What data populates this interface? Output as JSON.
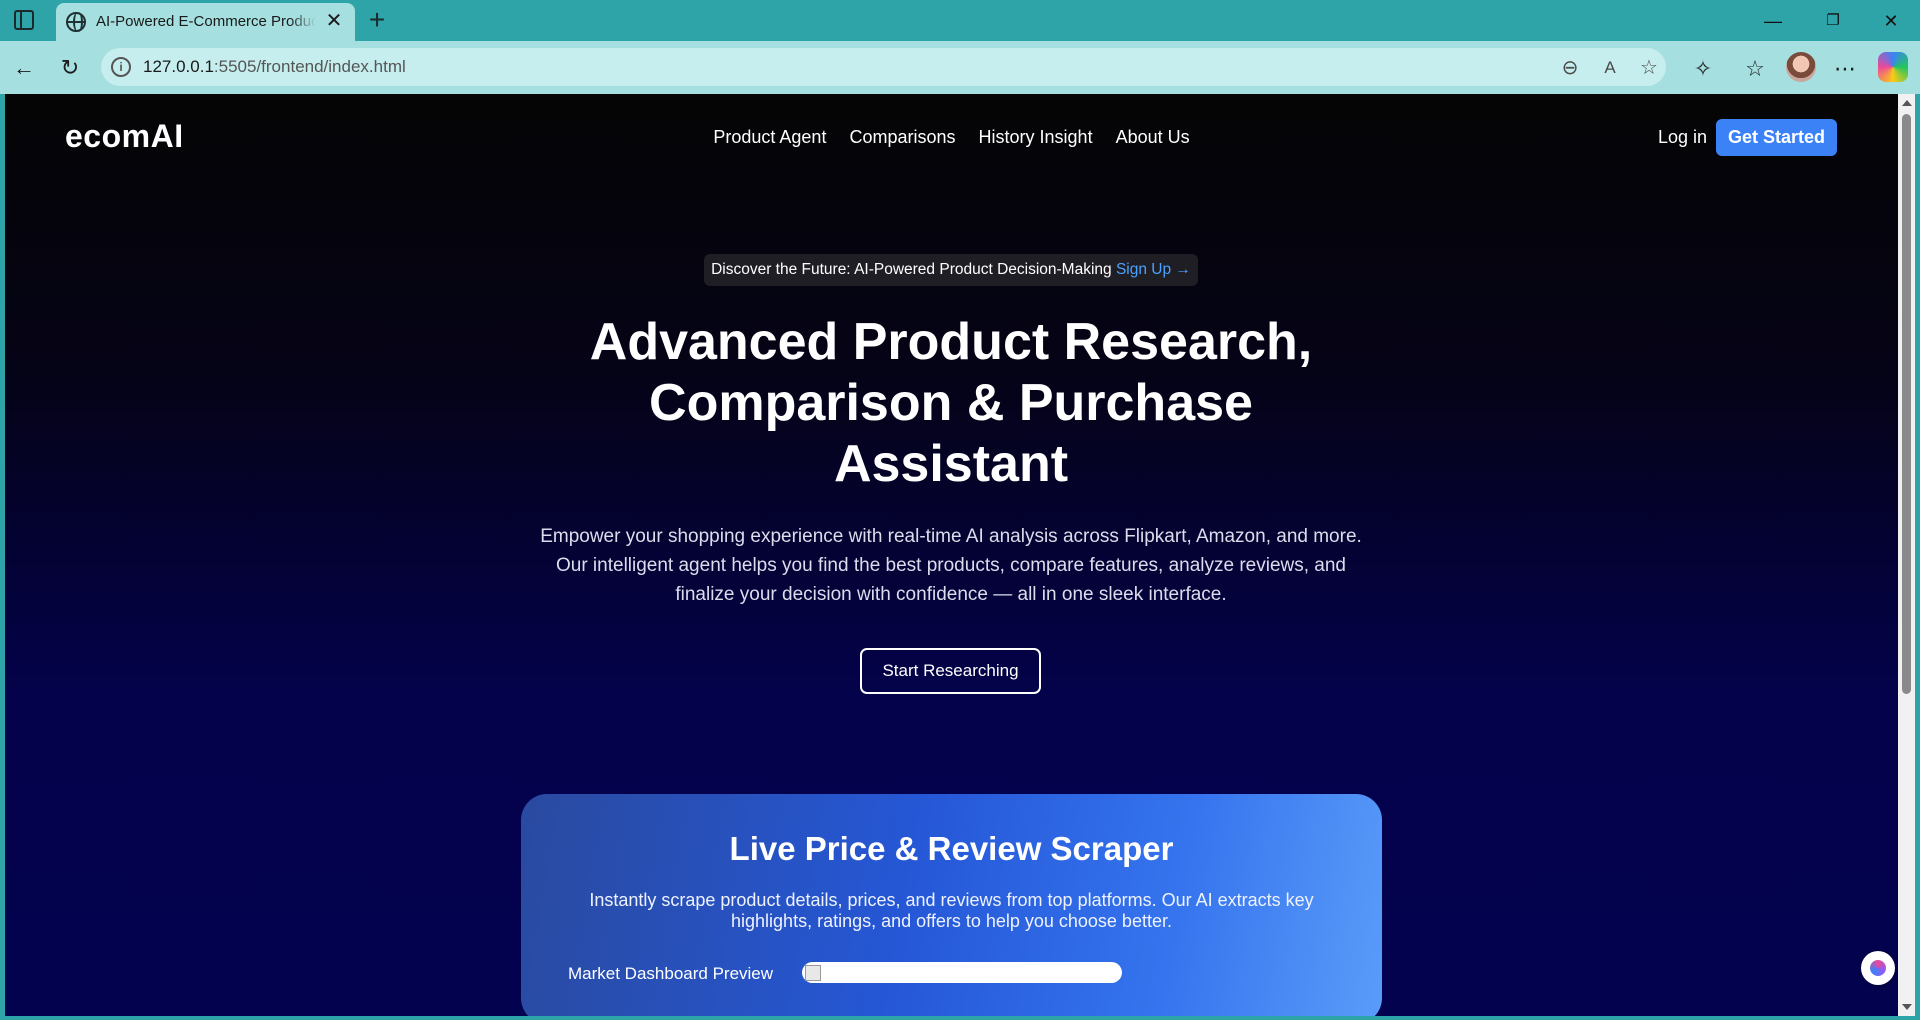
{
  "browser": {
    "tab_title": "AI-Powered E-Commerce Product Research",
    "tab_close": "✕",
    "new_tab": "+",
    "url_host": "127.0.0.1",
    "url_rest": ":5505/frontend/index.html",
    "window_controls": [
      "—",
      "❐",
      "✕"
    ]
  },
  "site": {
    "logo": "ecomAI",
    "nav": [
      "Product Agent",
      "Comparisons",
      "History Insight",
      "About Us"
    ],
    "login": "Log in",
    "get_started": "Get Started"
  },
  "hero": {
    "announcement": "Discover the Future: AI-Powered Product Decision-Making",
    "announcement_link": "Sign Up →",
    "title_line1": "Advanced Product Research,",
    "title_line2": "Comparison & Purchase",
    "title_line3": "Assistant",
    "description_line1": "Empower your shopping experience with real-time AI analysis across Flipkart, Amazon, and more.",
    "description_line2": "Our intelligent agent helps you find the best products, compare features, analyze reviews, and",
    "description_line3": "finalize your decision with confidence — all in one sleek interface.",
    "cta": "Start Researching"
  },
  "feature": {
    "title": "Live Price & Review Scraper",
    "description": "Instantly scrape product details, prices, and reviews from top platforms. Our AI extracts key highlights, ratings, and offers to help you choose better.",
    "dashboard_label": "Market Dashboard Preview"
  },
  "colors": {
    "accent": "#3b82f6",
    "link": "#4aa3ff",
    "chrome": "#2ea3a8",
    "toolbar": "#a5dfdf"
  }
}
